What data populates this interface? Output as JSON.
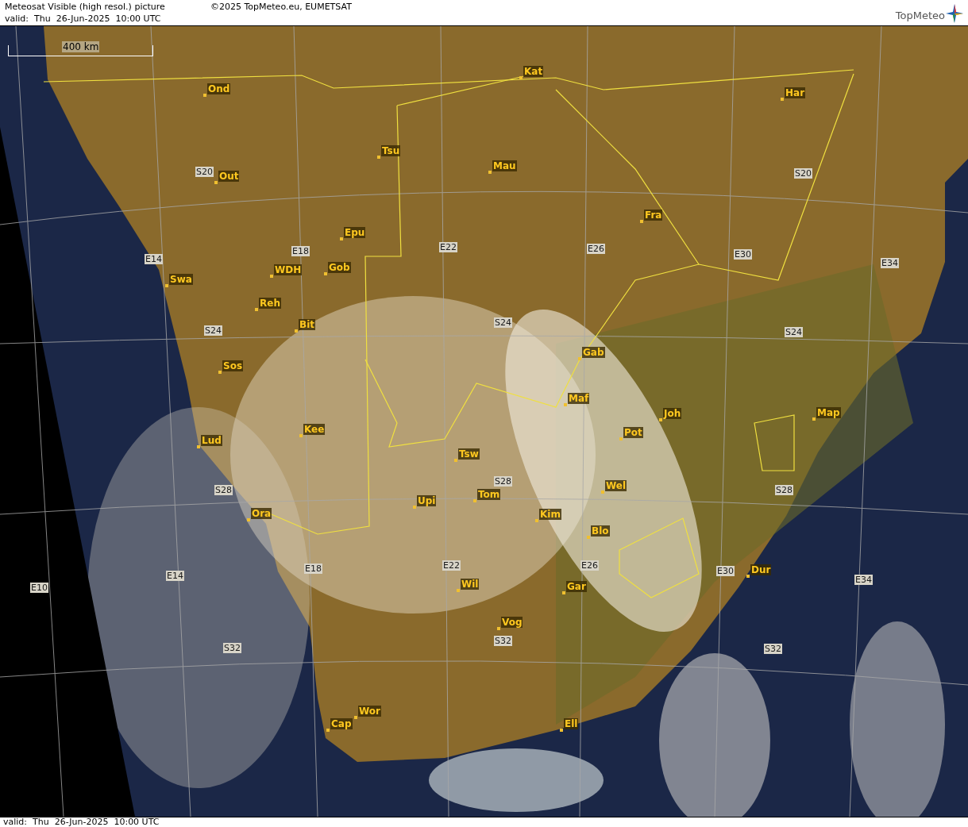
{
  "header": {
    "title": "Meteosat Visible (high resol.) picture",
    "valid": "valid:  Thu  26-Jun-2025  10:00 UTC",
    "copyright": "©2025 TopMeteo.eu, EUMETSAT",
    "logo": "TopMeteo"
  },
  "scale_bar": {
    "label": "400 km"
  },
  "map": {
    "cities": [
      "Ond",
      "Kat",
      "Har",
      "Tsu",
      "Mau",
      "Out",
      "Fra",
      "Epu",
      "WDH",
      "Gob",
      "Swa",
      "Reh",
      "Bit",
      "Sos",
      "Gab",
      "Maf",
      "Joh",
      "Map",
      "Lud",
      "Kee",
      "Pot",
      "Tsw",
      "Wel",
      "Upi",
      "Tom",
      "Ora",
      "Kim",
      "Blo",
      "Dur",
      "Wil",
      "Gar",
      "Vog",
      "Wor",
      "Cap",
      "Ell"
    ],
    "grid_labels": [
      "S20",
      "S20",
      "E14",
      "E18",
      "E22",
      "E26",
      "E30",
      "E34",
      "S24",
      "S24",
      "S24",
      "S28",
      "S28",
      "S28",
      "E10",
      "E14",
      "E18",
      "E22",
      "E26",
      "E30",
      "E34",
      "S32",
      "S32",
      "S32"
    ]
  },
  "footer": {
    "valid": "valid:  Thu  26-Jun-2025  10:00 UTC"
  }
}
